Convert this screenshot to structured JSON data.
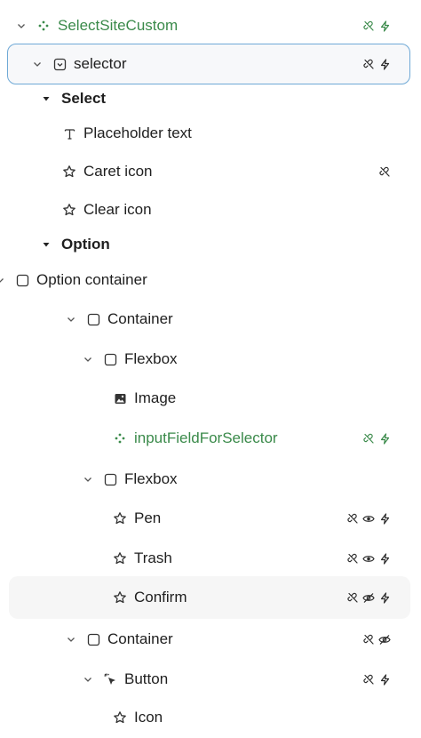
{
  "rows": [
    {
      "label": "SelectSiteCustom",
      "icon": "component-dots-icon",
      "chevron": "down",
      "indent": 0,
      "green": true,
      "actions": [
        "unlink-icon",
        "bolt-icon"
      ]
    },
    {
      "label": "selector",
      "icon": "selector-box-icon",
      "chevron": "down",
      "indent": 1,
      "selected": true,
      "actions": [
        "unlink-icon",
        "bolt-icon"
      ]
    },
    {
      "label": "Select",
      "icon": null,
      "chevron": "caret",
      "indent": 2,
      "bold": true,
      "actions": []
    },
    {
      "label": "Placeholder text",
      "icon": "text-t-icon",
      "chevron": null,
      "indent": 3,
      "actions": []
    },
    {
      "label": "Caret icon",
      "icon": "star-icon",
      "chevron": null,
      "indent": 3,
      "actions": [
        "unlink-icon"
      ]
    },
    {
      "label": "Clear icon",
      "icon": "star-icon",
      "chevron": null,
      "indent": 3,
      "actions": []
    },
    {
      "label": "Option",
      "icon": null,
      "chevron": "caret",
      "indent": 2,
      "bold": true,
      "actions": []
    },
    {
      "label": "Option container",
      "icon": "square-icon",
      "chevron": "down",
      "indent": 3,
      "actions": []
    },
    {
      "label": "Container",
      "icon": "square-icon",
      "chevron": "down",
      "indent": 4,
      "actions": []
    },
    {
      "label": "Flexbox",
      "icon": "square-icon",
      "chevron": "down",
      "indent": 5,
      "actions": []
    },
    {
      "label": "Image",
      "icon": "image-icon",
      "chevron": null,
      "indent": 6,
      "actions": []
    },
    {
      "label": "inputFieldForSelector",
      "icon": "component-dots-icon",
      "chevron": null,
      "indent": 6,
      "green": true,
      "actions": [
        "unlink-icon",
        "bolt-icon"
      ]
    },
    {
      "label": "Flexbox",
      "icon": "square-icon",
      "chevron": "down",
      "indent": 5,
      "actions": []
    },
    {
      "label": "Pen",
      "icon": "star-icon",
      "chevron": null,
      "indent": 6,
      "actions": [
        "unlink-icon",
        "eye-icon",
        "bolt-icon"
      ]
    },
    {
      "label": "Trash",
      "icon": "star-icon",
      "chevron": null,
      "indent": 6,
      "actions": [
        "unlink-icon",
        "eye-icon",
        "bolt-icon"
      ]
    },
    {
      "label": "Confirm",
      "icon": "star-icon",
      "chevron": null,
      "indent": 6,
      "hovered": true,
      "actions": [
        "unlink-icon",
        "eye-off-icon",
        "bolt-icon"
      ]
    },
    {
      "label": "Container",
      "icon": "square-icon",
      "chevron": "down",
      "indent": 4,
      "actions": [
        "unlink-icon",
        "eye-off-icon"
      ]
    },
    {
      "label": "Button",
      "icon": "cursor-click-icon",
      "chevron": "down",
      "indent": 5,
      "actions": [
        "unlink-icon",
        "bolt-icon"
      ]
    },
    {
      "label": "Icon",
      "icon": "star-icon",
      "chevron": null,
      "indent": 6,
      "actions": []
    }
  ]
}
